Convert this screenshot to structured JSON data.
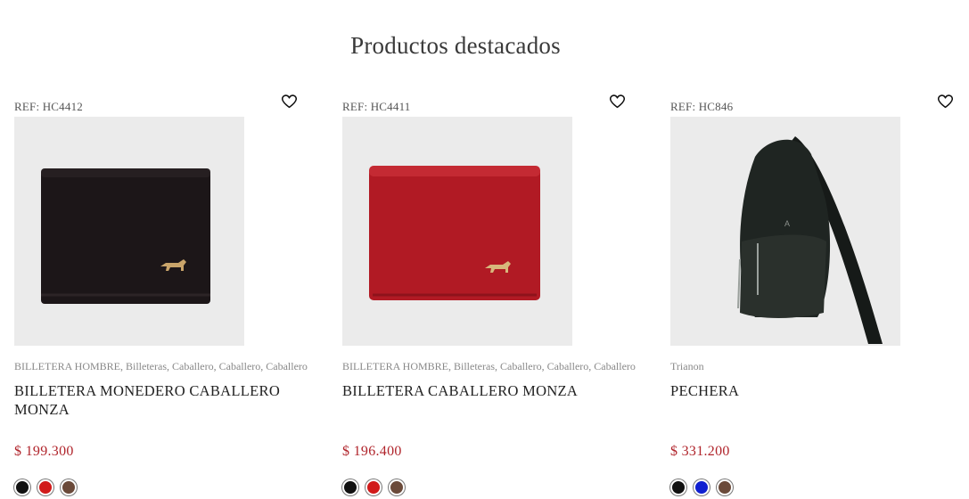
{
  "section": {
    "title": "Productos destacados"
  },
  "products": [
    {
      "ref": "REF: HC4412",
      "image": "dark-brown-bifold-wallet",
      "categories": "BILLETERA HOMBRE, Billeteras, Caballero, Caballero, Caballero",
      "name": "BILLETERA MONEDERO CABALLERO MONZA",
      "price": "$ 199.300",
      "colors": [
        "#111111",
        "#d11a1a",
        "#6b4a3a"
      ]
    },
    {
      "ref": "REF: HC4411",
      "image": "red-bifold-wallet",
      "categories": "BILLETERA HOMBRE, Billeteras, Caballero, Caballero, Caballero",
      "name": "BILLETERA CABALLERO MONZA",
      "price": "$ 196.400",
      "colors": [
        "#111111",
        "#d11a1a",
        "#6b4a3a"
      ]
    },
    {
      "ref": "REF: HC846",
      "image": "black-leather-sling-bag",
      "categories": "Trianon",
      "name": "PECHERA",
      "price": "$ 331.200",
      "colors": [
        "#111111",
        "#1020d0",
        "#6b4a3a"
      ]
    }
  ],
  "colors": {
    "price": "#b0242b",
    "image_bg": "#ebebeb"
  }
}
